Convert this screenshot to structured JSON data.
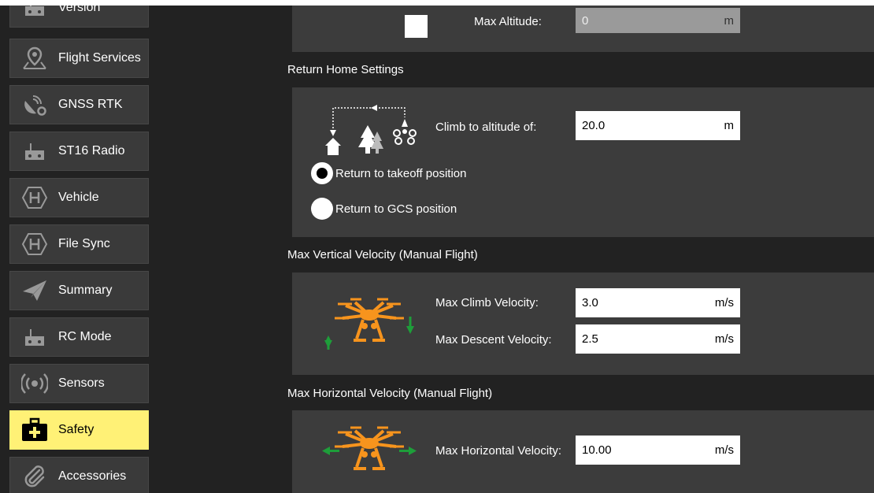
{
  "sidebar": {
    "items": [
      {
        "label": "Version",
        "icon": "radio-controller-icon"
      },
      {
        "label": "Flight Services",
        "icon": "map-pin-icon"
      },
      {
        "label": "GNSS RTK",
        "icon": "satellite-gear-icon"
      },
      {
        "label": "ST16 Radio",
        "icon": "radio-controller-icon"
      },
      {
        "label": "Vehicle",
        "icon": "hexagon-h-icon"
      },
      {
        "label": "File Sync",
        "icon": "hexagon-h-icon"
      },
      {
        "label": "Summary",
        "icon": "paper-plane-icon"
      },
      {
        "label": "RC Mode",
        "icon": "radio-controller-icon"
      },
      {
        "label": "Sensors",
        "icon": "broadcast-icon"
      },
      {
        "label": "Safety",
        "icon": "first-aid-kit-icon",
        "active": true
      },
      {
        "label": "Accessories",
        "icon": "paperclip-icon"
      }
    ]
  },
  "geofence": {
    "max_altitude_label": "Max Altitude:",
    "max_altitude_value": "0",
    "max_altitude_unit": "m"
  },
  "return_home": {
    "title": "Return Home Settings",
    "climb_label": "Climb to altitude of:",
    "climb_value": "20.0",
    "climb_unit": "m",
    "option_takeoff": "Return to takeoff position",
    "option_gcs": "Return to GCS position",
    "selected": "takeoff"
  },
  "vertical_velocity": {
    "title": "Max Vertical Velocity (Manual Flight)",
    "climb_label": "Max Climb Velocity:",
    "climb_value": "3.0",
    "climb_unit": "m/s",
    "descent_label": "Max Descent Velocity:",
    "descent_value": "2.5",
    "descent_unit": "m/s"
  },
  "horizontal_velocity": {
    "title": "Max Horizontal Velocity (Manual Flight)",
    "label": "Max Horizontal Velocity:",
    "value": "10.00",
    "unit": "m/s"
  },
  "colors": {
    "active_item": "#fff176",
    "drone_orange": "#f7941d",
    "arrow_green": "#1e9e3a",
    "panel_bg": "#3c3c3c",
    "page_bg": "#222222"
  }
}
